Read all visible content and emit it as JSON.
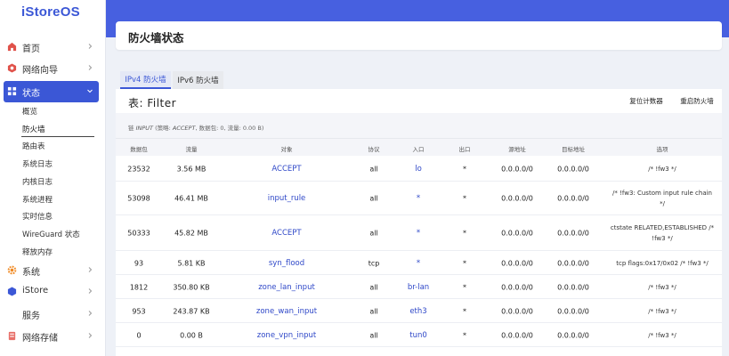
{
  "app": {
    "logo": "iStoreOS"
  },
  "sidebar": {
    "items": [
      {
        "label": "首页",
        "icon": "home-icon"
      },
      {
        "label": "网络向导",
        "icon": "network-wizard-icon"
      },
      {
        "label": "状态",
        "icon": "status-grid-icon"
      },
      {
        "label": "系统",
        "icon": "gear-icon"
      },
      {
        "label": "iStore",
        "icon": "store-icon"
      },
      {
        "label": "服务",
        "icon": "service-icon"
      },
      {
        "label": "网络存储",
        "icon": "storage-icon"
      }
    ],
    "sub_items": [
      "概览",
      "防火墙",
      "路由表",
      "系统日志",
      "内核日志",
      "系统进程",
      "实时信息",
      "WireGuard 状态",
      "释放内存"
    ]
  },
  "page": {
    "title": "防火墙状态"
  },
  "tabs": [
    {
      "label": "IPv4 防火墙"
    },
    {
      "label": "IPv6 防火墙"
    }
  ],
  "table": {
    "title": "表: Filter",
    "reset_label": "复位计数器",
    "restart_label": "重启防火墙",
    "chain_prefix": "链",
    "chain_name": "INPUT",
    "chain_policy_label": "(策略:",
    "chain_policy": "ACCEPT",
    "chain_stats": ", 数据包: 0, 流量: 0.00 B)",
    "headers": [
      "数据包",
      "流量",
      "对象",
      "协议",
      "入口",
      "出口",
      "源地址",
      "目标地址",
      "选项"
    ],
    "rows": [
      {
        "packets": "23532",
        "traffic": "3.56 MB",
        "target": "ACCEPT",
        "proto": "all",
        "in": "lo",
        "out": "*",
        "src": "0.0.0.0/0",
        "dst": "0.0.0.0/0",
        "options": "/* !fw3 */"
      },
      {
        "packets": "53098",
        "traffic": "46.41 MB",
        "target": "input_rule",
        "proto": "all",
        "in": "*",
        "out": "*",
        "src": "0.0.0.0/0",
        "dst": "0.0.0.0/0",
        "options": "/* !fw3: Custom input rule chain */"
      },
      {
        "packets": "50333",
        "traffic": "45.82 MB",
        "target": "ACCEPT",
        "proto": "all",
        "in": "*",
        "out": "*",
        "src": "0.0.0.0/0",
        "dst": "0.0.0.0/0",
        "options": "ctstate RELATED,ESTABLISHED /* !fw3 */"
      },
      {
        "packets": "93",
        "traffic": "5.81 KB",
        "target": "syn_flood",
        "proto": "tcp",
        "in": "*",
        "out": "*",
        "src": "0.0.0.0/0",
        "dst": "0.0.0.0/0",
        "options": "tcp flags:0x17/0x02 /* !fw3 */"
      },
      {
        "packets": "1812",
        "traffic": "350.80 KB",
        "target": "zone_lan_input",
        "proto": "all",
        "in": "br-lan",
        "out": "*",
        "src": "0.0.0.0/0",
        "dst": "0.0.0.0/0",
        "options": "/* !fw3 */"
      },
      {
        "packets": "953",
        "traffic": "243.87 KB",
        "target": "zone_wan_input",
        "proto": "all",
        "in": "eth3",
        "out": "*",
        "src": "0.0.0.0/0",
        "dst": "0.0.0.0/0",
        "options": "/* !fw3 */"
      },
      {
        "packets": "0",
        "traffic": "0.00 B",
        "target": "zone_vpn_input",
        "proto": "all",
        "in": "tun0",
        "out": "*",
        "src": "0.0.0.0/0",
        "dst": "0.0.0.0/0",
        "options": "/* !fw3 */"
      }
    ]
  },
  "colors": {
    "accent": "#3b57d6",
    "banner": "#4760e0",
    "link": "#2f48c8"
  }
}
